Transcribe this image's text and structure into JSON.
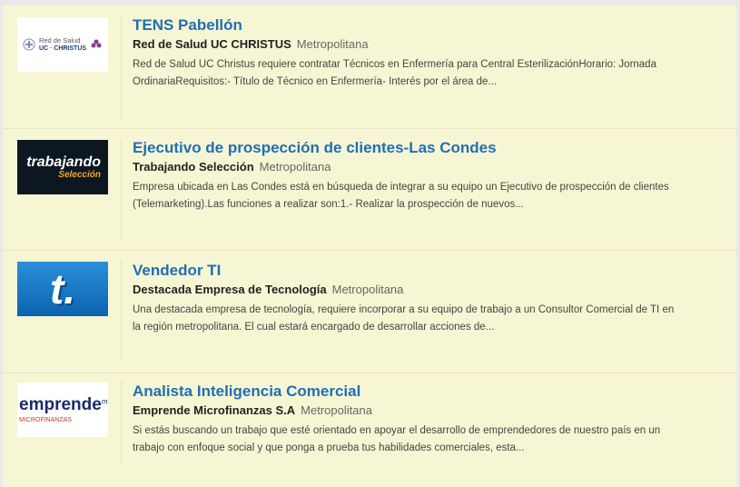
{
  "jobs": [
    {
      "title": "TENS Pabellón",
      "company": "Red de Salud UC CHRISTUS",
      "region": "Metropolitana",
      "description": "Red de Salud UC Christus requiere contratar Técnicos en Enfermería para Central EsterilizaciónHorario: Jornada OrdinariaRequisitos:- Título de Técnico en Enfermería- Interés por el área de...",
      "logo": {
        "line1": "Red de Salud",
        "line2": "UC · CHRISTUS"
      }
    },
    {
      "title": "Ejecutivo de prospección de clientes-Las Condes",
      "company": "Trabajando Selección",
      "region": "Metropolitana",
      "description": "Empresa ubicada en Las Condes está en búsqueda de integrar a su equipo un Ejecutivo de prospección de clientes (Telemarketing).Las funciones a realizar son:1.- Realizar la prospección de nuevos...",
      "logo": {
        "line1": "trabajando",
        "line2": "Selección"
      }
    },
    {
      "title": "Vendedor TI",
      "company": "Destacada Empresa de Tecnología",
      "region": "Metropolitana",
      "description": "Una destacada empresa de tecnología, requiere incorporar a su equipo de trabajo a un Consultor Comercial de TI en la región metropolitana. El cual estará encargado de desarrollar acciones de...",
      "logo": {
        "line1": "t."
      }
    },
    {
      "title": "Analista Inteligencia Comercial",
      "company": "Emprende Microfinanzas S.A",
      "region": "Metropolitana",
      "description": "Si estás buscando un trabajo que esté orientado en apoyar el desarrollo de emprendedores de nuestro país en un trabajo con enfoque social y que ponga a prueba tus habilidades comerciales, esta...",
      "logo": {
        "line1": "emprende",
        "line2": "MICROFINANZAS",
        "sup": "mf"
      }
    }
  ],
  "colors": {
    "title": "#1f6fb5",
    "background": "#f7f6d4"
  }
}
